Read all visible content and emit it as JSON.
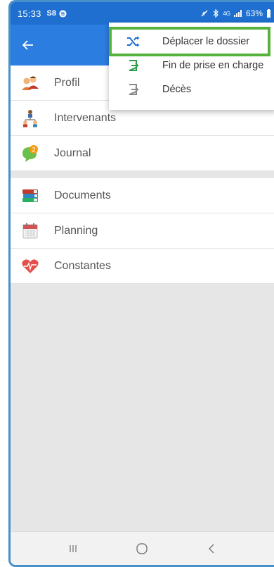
{
  "statusbar": {
    "time": "15:33",
    "left_icons": "S8",
    "signal_text": "4G",
    "battery": "63%"
  },
  "list_group1": [
    {
      "label": "Profil",
      "icon": "users-icon"
    },
    {
      "label": "Intervenants",
      "icon": "team-icon"
    },
    {
      "label": "Journal",
      "icon": "chat-badge-icon",
      "badge": "2"
    }
  ],
  "list_group2": [
    {
      "label": "Documents",
      "icon": "books-icon"
    },
    {
      "label": "Planning",
      "icon": "calendar-icon"
    },
    {
      "label": "Constantes",
      "icon": "heart-pulse-icon"
    }
  ],
  "menu": {
    "items": [
      {
        "label": "Déplacer le dossier",
        "icon": "shuffle-icon"
      },
      {
        "label": "Fin de prise en charge",
        "icon": "exit-green-icon"
      },
      {
        "label": "Décès",
        "icon": "exit-gray-icon"
      }
    ]
  },
  "colors": {
    "appbar": "#2b7de0",
    "statusbar": "#1e6fd0",
    "highlight": "#57b23d"
  }
}
